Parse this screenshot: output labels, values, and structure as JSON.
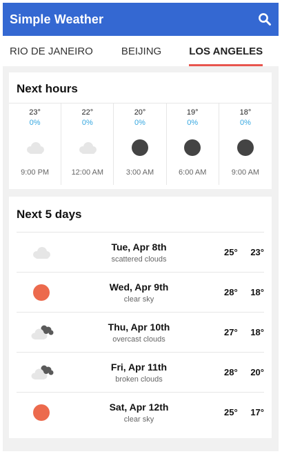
{
  "appbar": {
    "title": "Simple Weather",
    "search_icon": "search-icon"
  },
  "tabs": [
    {
      "label": "RIO DE JANEIRO",
      "active": false
    },
    {
      "label": "BEIJING",
      "active": false
    },
    {
      "label": "LOS ANGELES",
      "active": true
    }
  ],
  "hourly": {
    "title": "Next hours",
    "items": [
      {
        "temp": "23°",
        "pop": "0%",
        "icon": "cloud-icon",
        "time": "9:00 PM"
      },
      {
        "temp": "22°",
        "pop": "0%",
        "icon": "cloud-icon",
        "time": "12:00 AM"
      },
      {
        "temp": "20°",
        "pop": "0%",
        "icon": "moon-icon",
        "time": "3:00 AM"
      },
      {
        "temp": "19°",
        "pop": "0%",
        "icon": "moon-icon",
        "time": "6:00 AM"
      },
      {
        "temp": "18°",
        "pop": "0%",
        "icon": "moon-icon",
        "time": "9:00 AM"
      }
    ]
  },
  "daily": {
    "title": "Next 5 days",
    "items": [
      {
        "date": "Tue, Apr 8th",
        "desc": "scattered clouds",
        "high": "25°",
        "low": "23°",
        "icon": "cloud-icon"
      },
      {
        "date": "Wed, Apr 9th",
        "desc": "clear sky",
        "high": "28°",
        "low": "18°",
        "icon": "sun-icon"
      },
      {
        "date": "Thu, Apr 10th",
        "desc": "overcast clouds",
        "high": "27°",
        "low": "18°",
        "icon": "overcast-clouds-icon"
      },
      {
        "date": "Fri, Apr 11th",
        "desc": "broken clouds",
        "high": "28°",
        "low": "20°",
        "icon": "broken-clouds-icon"
      },
      {
        "date": "Sat, Apr 12th",
        "desc": "clear sky",
        "high": "25°",
        "low": "17°",
        "icon": "sun-icon"
      }
    ]
  },
  "colors": {
    "appbar": "#3468d2",
    "tab_indicator": "#e8554e",
    "precip_text": "#35a7e0",
    "sun": "#ec6a4d",
    "moon": "#444444",
    "cloud_light": "#e6e6e6",
    "cloud_dark": "#5a5a5a"
  }
}
